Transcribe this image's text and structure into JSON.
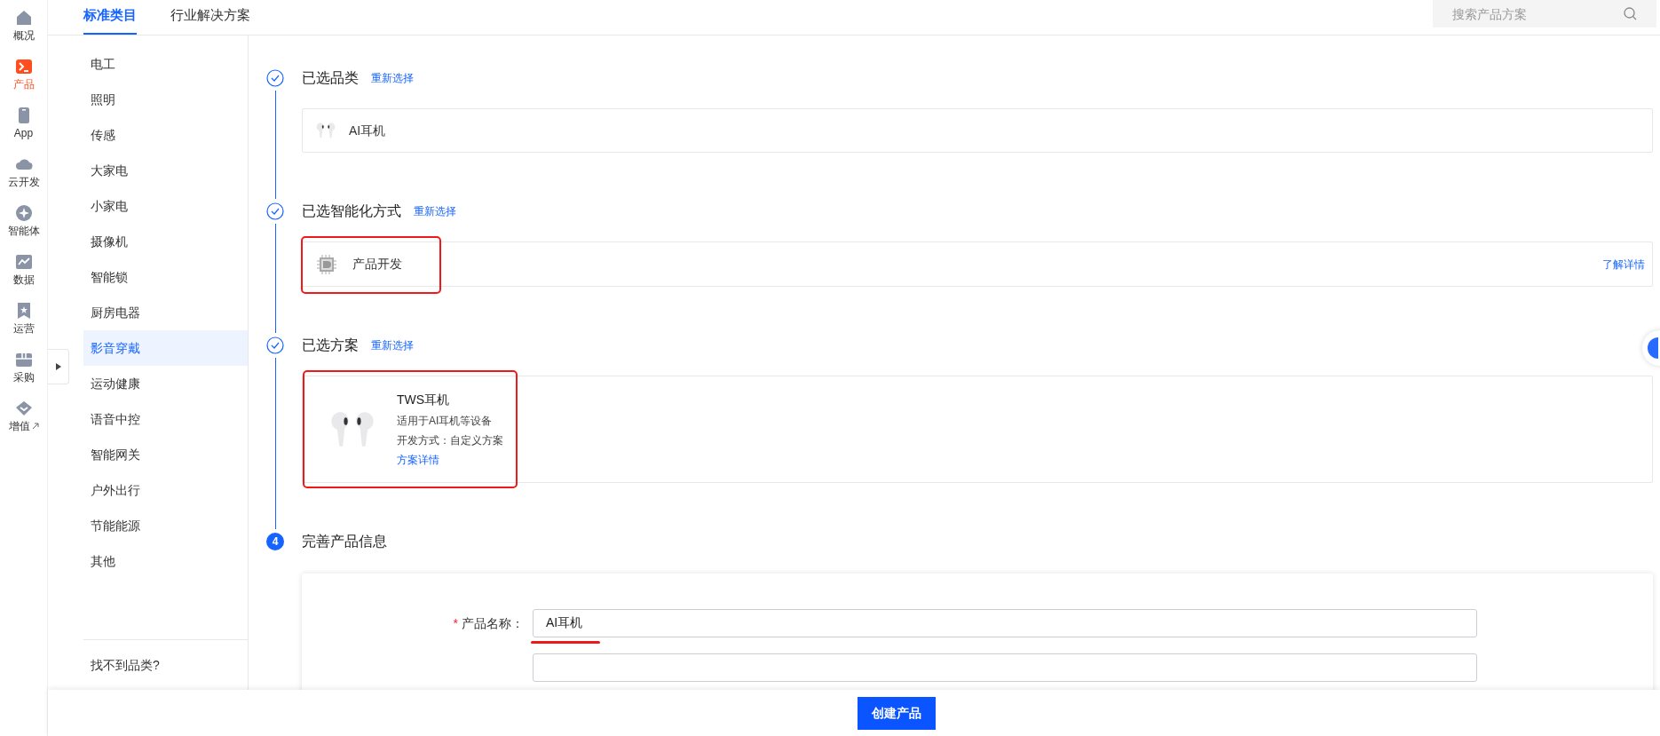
{
  "nav": [
    {
      "label": "概况",
      "selected": false,
      "external": false
    },
    {
      "label": "产品",
      "selected": true,
      "external": false
    },
    {
      "label": "App",
      "selected": false,
      "external": false
    },
    {
      "label": "云开发",
      "selected": false,
      "external": false
    },
    {
      "label": "智能体",
      "selected": false,
      "external": false
    },
    {
      "label": "数据",
      "selected": false,
      "external": false
    },
    {
      "label": "运营",
      "selected": false,
      "external": false
    },
    {
      "label": "采购",
      "selected": false,
      "external": false
    },
    {
      "label": "增值",
      "selected": false,
      "external": true
    }
  ],
  "category_tabs": [
    {
      "label": "标准类目",
      "selected": true
    },
    {
      "label": "行业解决方案",
      "selected": false
    }
  ],
  "search": {
    "placeholder": "搜索产品方案"
  },
  "categories": [
    {
      "label": "电工",
      "selected": false
    },
    {
      "label": "照明",
      "selected": false
    },
    {
      "label": "传感",
      "selected": false
    },
    {
      "label": "大家电",
      "selected": false
    },
    {
      "label": "小家电",
      "selected": false
    },
    {
      "label": "摄像机",
      "selected": false
    },
    {
      "label": "智能锁",
      "selected": false
    },
    {
      "label": "厨房电器",
      "selected": false
    },
    {
      "label": "影音穿戴",
      "selected": true
    },
    {
      "label": "运动健康",
      "selected": false
    },
    {
      "label": "语音中控",
      "selected": false
    },
    {
      "label": "智能网关",
      "selected": false
    },
    {
      "label": "户外出行",
      "selected": false
    },
    {
      "label": "节能能源",
      "selected": false
    },
    {
      "label": "其他",
      "selected": false
    }
  ],
  "category_footer": "找不到品类?",
  "steps": [
    {
      "kind": "done",
      "title": "已选品类",
      "action": "重新选择",
      "card": {
        "kind": "category",
        "name": "AI耳机",
        "highlighted": false
      }
    },
    {
      "kind": "done",
      "title": "已选智能化方式",
      "action": "重新选择",
      "card": {
        "kind": "method",
        "name": "产品开发",
        "link": "了解详情",
        "highlighted": true
      }
    },
    {
      "kind": "done",
      "title": "已选方案",
      "action": "重新选择",
      "card": {
        "kind": "solution",
        "name": "TWS耳机",
        "description": "适用于AI耳机等设备",
        "mode": "开发方式：自定义方案",
        "link": "方案详情",
        "highlighted": true
      }
    },
    {
      "kind": "current",
      "number": "4",
      "title": "完善产品信息"
    }
  ],
  "form": {
    "fields": [
      {
        "label": "产品名称：",
        "required_mark": "*",
        "value": "AI耳机",
        "underlined": true
      },
      {
        "underlined": false
      }
    ]
  },
  "submit": "创建产品"
}
